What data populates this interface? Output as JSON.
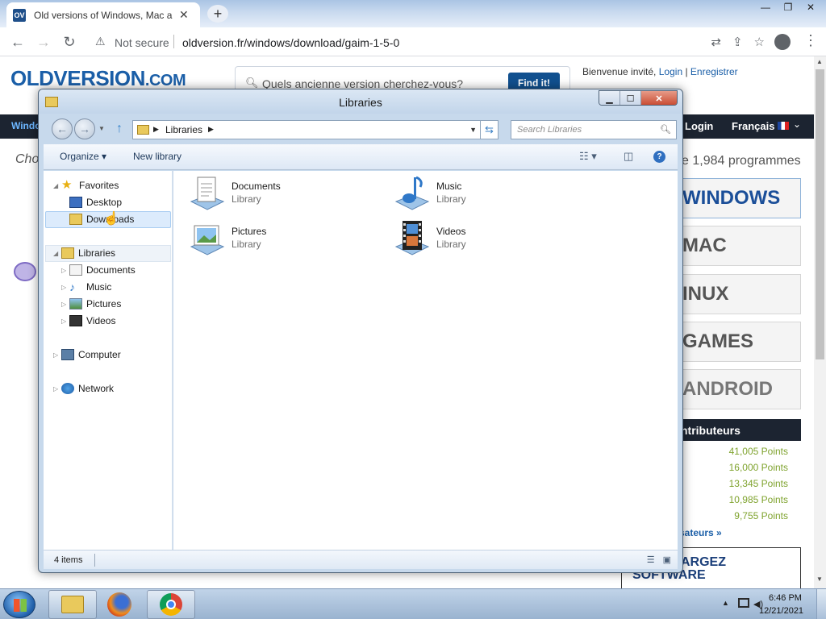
{
  "browser": {
    "tab_favicon": "OV",
    "tab_title": "Old versions of Windows, Mac and Linux software",
    "tab_close": "✕",
    "new_tab": "+",
    "security_label": "Not secure",
    "url": "oldversion.fr/windows/download/gaim-1-5-0",
    "window_controls": {
      "minimize": "—",
      "maximize": "❐",
      "close": "✕"
    }
  },
  "site": {
    "logo_main": "OLDVERSION",
    "logo_suffix": ".COM",
    "search_placeholder": "Quels ancienne version cherchez-vous?",
    "find_button": "Find it!",
    "welcome": "Bienvenue invité,",
    "login_link": "Login",
    "register_link": "Enregistrer",
    "nav_left": "Windo",
    "nav_login": "Login",
    "nav_language": "Français",
    "choose_text": "Cho",
    "program_count": "e 1,984 programmes",
    "os_buttons": [
      "WINDOWS",
      "MAC",
      "INUX",
      "GAMES",
      "ANDROID"
    ],
    "contributors_heading": "ntributeurs",
    "points": [
      "41,005 Points",
      "16,000 Points",
      "13,345 Points",
      "10,985 Points",
      "9,755 Points"
    ],
    "users_link": "sateurs »",
    "download_box_line1": "ARGEZ",
    "download_box_line2": "SOFTWARE"
  },
  "explorer": {
    "title": "Libraries",
    "address": "Libraries",
    "search_placeholder": "Search Libraries",
    "toolbar": {
      "organize": "Organize ▾",
      "new_library": "New library"
    },
    "nav": {
      "favorites": "Favorites",
      "desktop": "Desktop",
      "downloads": "Downloads",
      "libraries": "Libraries",
      "documents": "Documents",
      "music": "Music",
      "pictures": "Pictures",
      "videos": "Videos",
      "computer": "Computer",
      "network": "Network"
    },
    "items": [
      {
        "name": "Documents",
        "type": "Library"
      },
      {
        "name": "Music",
        "type": "Library"
      },
      {
        "name": "Pictures",
        "type": "Library"
      },
      {
        "name": "Videos",
        "type": "Library"
      }
    ],
    "status": "4 items"
  },
  "taskbar": {
    "time": "6:46 PM",
    "date": "12/21/2021"
  }
}
